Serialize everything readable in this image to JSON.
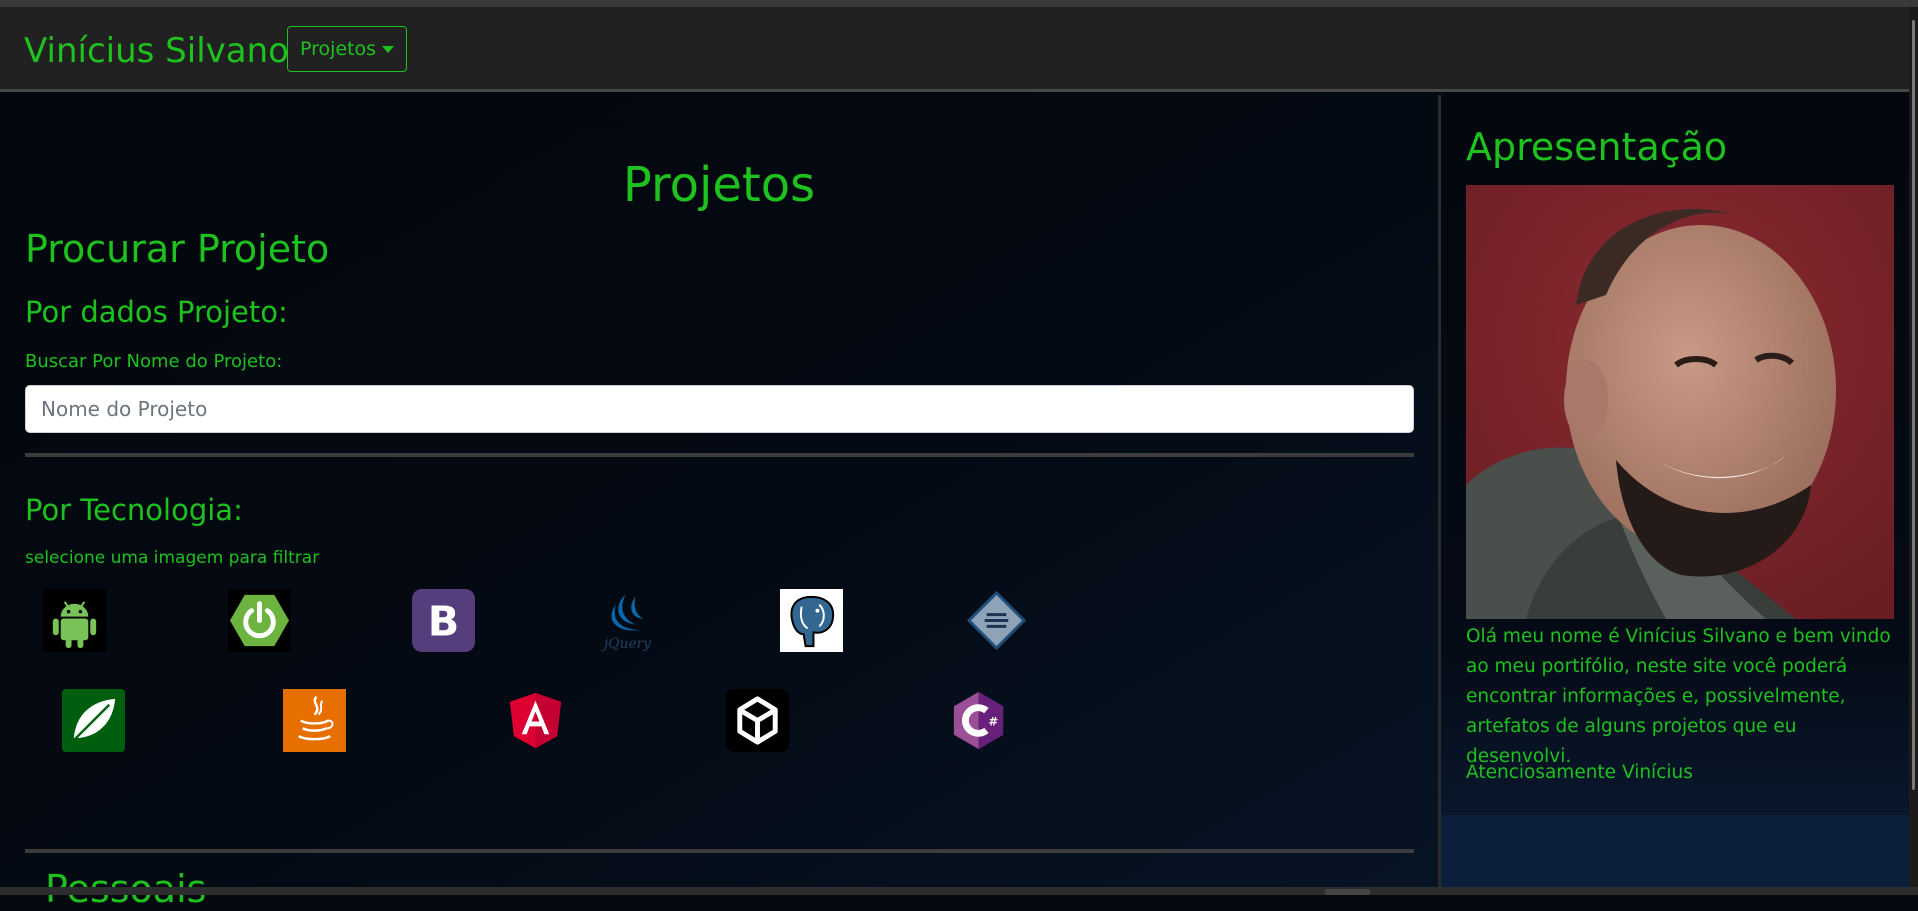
{
  "navbar": {
    "brand": "Vinícius Silvano",
    "dropdown_label": "Projetos"
  },
  "main": {
    "title": "Projetos",
    "search_heading": "Procurar Projeto",
    "by_data_heading": "Por dados Projeto:",
    "name_label": "Buscar Por Nome do Projeto:",
    "name_placeholder": "Nome do Projeto",
    "by_tech_heading": "Por Tecnologia:",
    "tech_hint": "selecione uma imagem para filtrar",
    "next_heading": "Pessoais",
    "technologies": [
      {
        "name": "android-icon",
        "color": "#78c257"
      },
      {
        "name": "spring-icon",
        "color": "#6db33f"
      },
      {
        "name": "bootstrap-icon",
        "color": "#563d7c"
      },
      {
        "name": "jquery-icon",
        "color": "#0868ac"
      },
      {
        "name": "postgresql-icon",
        "color": "#336791"
      },
      {
        "name": "netbeans-icon",
        "color": "#8fa3b8"
      },
      {
        "name": "thymeleaf-icon",
        "color": "#005f0f"
      },
      {
        "name": "java-icon",
        "color": "#e76f00"
      },
      {
        "name": "angular-icon",
        "color": "#dd0031"
      },
      {
        "name": "unity-icon",
        "color": "#000000"
      },
      {
        "name": "csharp-icon",
        "color": "#9b4f96"
      }
    ]
  },
  "sidebar": {
    "title": "Apresentação",
    "text": "Olá meu nome é Vinícius Silvano e bem vindo ao meu portifólio, neste site você poderá encontrar informações e, possivelmente, artefatos de alguns projetos que eu desenvolvi.",
    "signature": "Atenciosamente Vinícius"
  },
  "colors": {
    "accent": "#1ec21e",
    "navbar_bg": "#212121",
    "page_bg": "#04080f"
  }
}
